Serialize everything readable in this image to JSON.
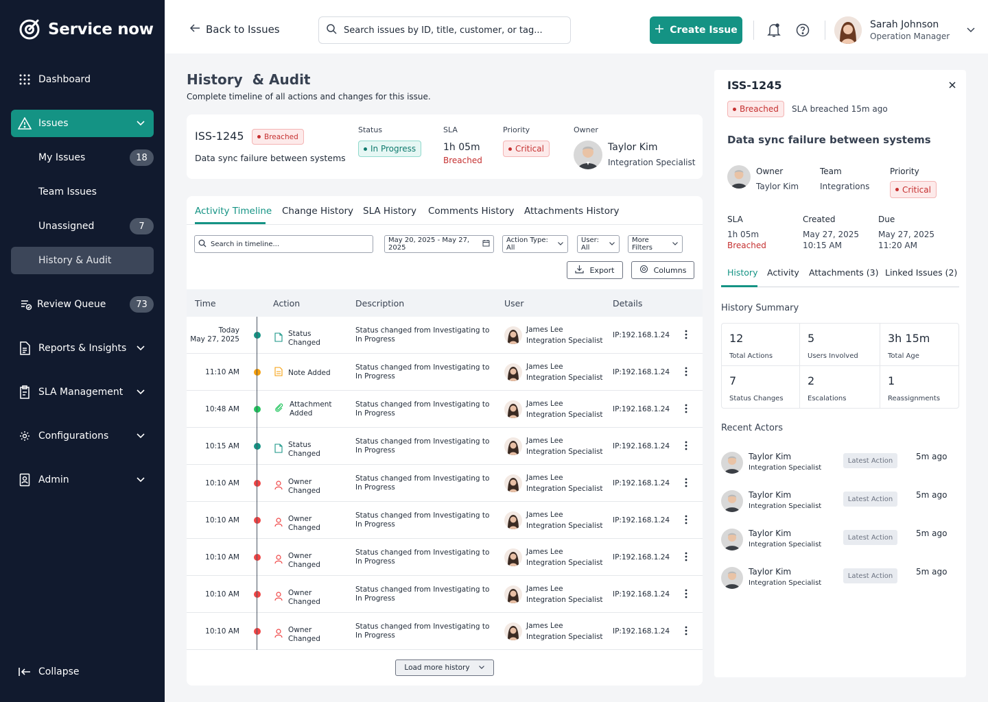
{
  "sidebar": {
    "logo": "Service now",
    "items": {
      "dashboard": "Dashboard",
      "issues": "Issues",
      "my_issues": "My Issues",
      "my_issues_count": "18",
      "team_issues": "Team Issues",
      "unassigned": "Unassigned",
      "unassigned_count": "7",
      "history_audit": "History & Audit",
      "review_queue": "Review Queue",
      "review_queue_count": "73",
      "reports": "Reports & Insights",
      "sla": "SLA Management",
      "configurations": "Configurations",
      "admin": "Admin"
    },
    "collapse": "Collapse"
  },
  "topbar": {
    "back": "Back to Issues",
    "search_placeholder": "Search issues by ID, title, customer, or tag...",
    "create": "Create Issue",
    "user_name": "Sarah Johnson",
    "user_role": "Operation Manager"
  },
  "page": {
    "title": "History  & Audit",
    "subtitle": "Complete timeline of all actions and changes for this issue."
  },
  "issue": {
    "id": "ISS-1245",
    "breach": "Breached",
    "title": "Data sync failure between systems",
    "status_label": "Status",
    "status": "In Progress",
    "sla_label": "SLA",
    "sla_value": "1h 05m",
    "sla_state": "Breached",
    "priority_label": "Priority",
    "priority": "Critical",
    "owner_label": "Owner",
    "owner_name": "Taylor Kim",
    "owner_role": "Integration Specialist"
  },
  "tabs": [
    "Activity Timeline",
    "Change History",
    "SLA History",
    "Comments History",
    "Attachments History"
  ],
  "filters": {
    "search_placeholder": "Search in timeline...",
    "date_range": "May 20, 2025 - May 27, 2025",
    "action_type": "Action Type: All",
    "user": "User: All",
    "more": "More Filters",
    "export": "Export",
    "columns": "Columns"
  },
  "table": {
    "headers": [
      "Time",
      "Action",
      "Description",
      "User",
      "Details"
    ],
    "rows": [
      {
        "time1": "Today",
        "time2": "May 27, 2025",
        "action1": "Status Changed",
        "action2": "",
        "kind": "status",
        "color": "#149384",
        "desc": "Status changed from Investigating to In Progress",
        "user": "James Lee",
        "role": "Integration Specialist",
        "detail": "IP:192.168.1.24"
      },
      {
        "time1": "11:10 AM",
        "time2": "",
        "action1": "Note Added",
        "action2": "",
        "kind": "note",
        "color": "#f59e0b",
        "desc": "Status changed from Investigating to In Progress",
        "user": "James Lee",
        "role": "Integration Specialist",
        "detail": "IP:192.168.1.24"
      },
      {
        "time1": "10:48 AM",
        "time2": "",
        "action1": "Attachment",
        "action2": "Added",
        "kind": "attach",
        "color": "#22c55e",
        "desc": "Status changed from Investigating to In Progress",
        "user": "James Lee",
        "role": "Integration Specialist",
        "detail": "IP:192.168.1.24"
      },
      {
        "time1": "10:15 AM",
        "time2": "",
        "action1": "Status Changed",
        "action2": "",
        "kind": "status",
        "color": "#149384",
        "desc": "Status changed from Investigating to In Progress",
        "user": "James Lee",
        "role": "Integration Specialist",
        "detail": "IP:192.168.1.24"
      },
      {
        "time1": "10:10 AM",
        "time2": "",
        "action1": "Owner Changed",
        "action2": "",
        "kind": "owner",
        "color": "#ef4444",
        "desc": "Status changed from Investigating to In Progress",
        "user": "James Lee",
        "role": "Integration Specialist",
        "detail": "IP:192.168.1.24"
      },
      {
        "time1": "10:10 AM",
        "time2": "",
        "action1": "Owner Changed",
        "action2": "",
        "kind": "owner",
        "color": "#ef4444",
        "desc": "Status changed from Investigating to In Progress",
        "user": "James Lee",
        "role": "Integration Specialist",
        "detail": "IP:192.168.1.24"
      },
      {
        "time1": "10:10 AM",
        "time2": "",
        "action1": "Owner Changed",
        "action2": "",
        "kind": "owner",
        "color": "#ef4444",
        "desc": "Status changed from Investigating to In Progress",
        "user": "James Lee",
        "role": "Integration Specialist",
        "detail": "IP:192.168.1.24"
      },
      {
        "time1": "10:10 AM",
        "time2": "",
        "action1": "Owner Changed",
        "action2": "",
        "kind": "owner",
        "color": "#ef4444",
        "desc": "Status changed from Investigating to In Progress",
        "user": "James Lee",
        "role": "Integration Specialist",
        "detail": "IP:192.168.1.24"
      },
      {
        "time1": "10:10 AM",
        "time2": "",
        "action1": "Owner Changed",
        "action2": "",
        "kind": "owner",
        "color": "#ef4444",
        "desc": "Status changed from Investigating to In Progress",
        "user": "James Lee",
        "role": "Integration Specialist",
        "detail": "IP:192.168.1.24"
      }
    ],
    "load_more": "Load more history"
  },
  "panel": {
    "id": "ISS-1245",
    "breach": "Breached",
    "breach_note": "SLA breached 15m ago",
    "title": "Data sync failure between systems",
    "owner_label": "Owner",
    "owner": "Taylor Kim",
    "team_label": "Team",
    "team": "Integrations",
    "priority_label": "Priority",
    "priority": "Critical",
    "sla_label": "SLA",
    "sla": "1h 05m",
    "sla_state": "Breached",
    "created_label": "Created",
    "created_date": "May 27, 2025",
    "created_time": "10:15 AM",
    "due_label": "Due",
    "due_date": "May 27, 2025",
    "due_time": "11:20 AM",
    "tabs": [
      "History",
      "Activity",
      "Attachments (3)",
      "Linked Issues (2)"
    ],
    "summary_title": "History Summary",
    "summary": [
      {
        "value": "12",
        "label": "Total Actions"
      },
      {
        "value": "5",
        "label": "Users Involved"
      },
      {
        "value": "3h 15m",
        "label": "Total Age"
      },
      {
        "value": "7",
        "label": "Status Changes"
      },
      {
        "value": "2",
        "label": "Escalations"
      },
      {
        "value": "1",
        "label": "Reassignments"
      }
    ],
    "actors_title": "Recent Actors",
    "actors": [
      {
        "name": "Taylor Kim",
        "role": "Integration Specialist",
        "tag": "Latest Action",
        "ago": "5m ago"
      },
      {
        "name": "Taylor Kim",
        "role": "Integration Specialist",
        "tag": "Latest Action",
        "ago": "5m ago"
      },
      {
        "name": "Taylor Kim",
        "role": "Integration Specialist",
        "tag": "Latest Action",
        "ago": "5m ago"
      },
      {
        "name": "Taylor Kim",
        "role": "Integration Specialist",
        "tag": "Latest Action",
        "ago": "5m ago"
      }
    ]
  },
  "colors": {
    "accent": "#149384",
    "sidebar": "#111a2e",
    "danger": "#c53030"
  }
}
